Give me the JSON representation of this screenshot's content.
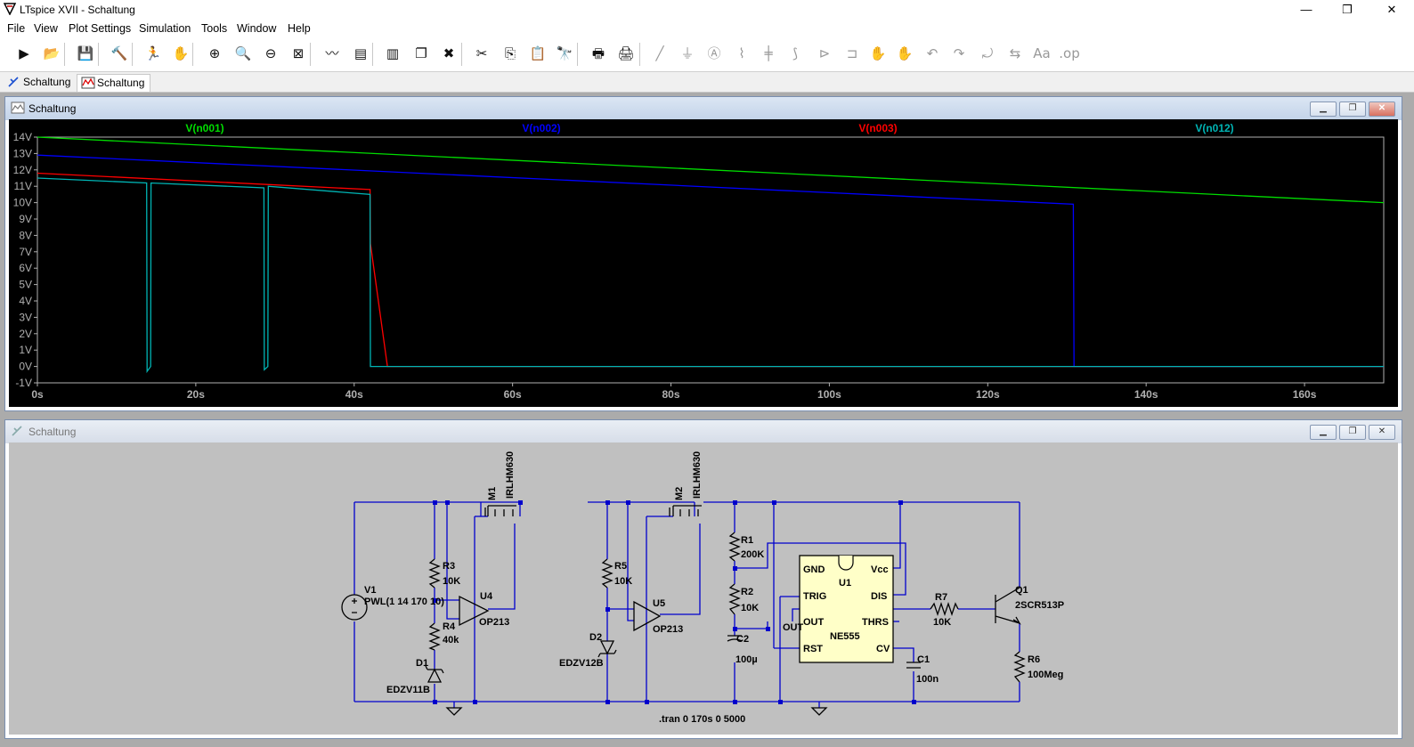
{
  "app": {
    "title": "LTspice XVII - Schaltung",
    "window_controls": [
      "—",
      "❐",
      "✕"
    ]
  },
  "menu": [
    "File",
    "View",
    "Plot Settings",
    "Simulation",
    "Tools",
    "Window",
    "Help"
  ],
  "toolbar_icons": [
    "run-icon",
    "open-icon",
    "save-icon",
    "control-panel-icon",
    "halt-icon",
    "pan-icon",
    "zoom-in-icon",
    "zoom-area-icon",
    "zoom-out-icon",
    "zoom-fit-icon",
    "autorange-icon",
    "tile-vertical-icon",
    "tile-horizontal-icon",
    "cascade-icon",
    "close-all-icon",
    "cut-icon",
    "copy-icon",
    "paste-icon",
    "find-icon",
    "print-icon",
    "print-setup-icon",
    "wire-icon",
    "ground-icon",
    "label-icon",
    "resistor-icon",
    "capacitor-icon",
    "inductor-icon",
    "diode-icon",
    "component-icon",
    "move-icon",
    "drag-icon",
    "undo-icon",
    "redo-icon",
    "rotate-icon",
    "mirror-icon",
    "text-icon",
    "spice-directive-icon"
  ],
  "tabs": [
    {
      "label": "Schaltung",
      "icon": "schematic-icon"
    },
    {
      "label": "Schaltung",
      "icon": "waveform-icon"
    }
  ],
  "plot_window": {
    "title": "Schaltung",
    "chart_data": {
      "type": "line",
      "series": [
        {
          "name": "V(n001)",
          "color": "#00dd00",
          "x": [
            0,
            170
          ],
          "y": [
            14,
            10
          ]
        },
        {
          "name": "V(n002)",
          "color": "#0000ff",
          "x": [
            0,
            130.8,
            130.9,
            170
          ],
          "y": [
            12.9,
            9.9,
            0,
            0
          ]
        },
        {
          "name": "V(n003)",
          "color": "#ff0000",
          "x": [
            0,
            42,
            42.05,
            44.2,
            170
          ],
          "y": [
            11.8,
            10.8,
            7.5,
            0,
            0
          ]
        },
        {
          "name": "V(n012)",
          "color": "#00b4b4",
          "x": [
            0,
            13.8,
            13.85,
            14.3,
            14.35,
            28.6,
            28.65,
            29.1,
            29.15,
            42,
            42.05,
            170
          ],
          "y": [
            11.5,
            11.2,
            -0.3,
            0,
            11.2,
            10.9,
            -0.2,
            0,
            11,
            10.5,
            0,
            0
          ]
        }
      ],
      "xlim": [
        0,
        170
      ],
      "ylim": [
        -1,
        14
      ],
      "xticks": [
        "0s",
        "20s",
        "40s",
        "60s",
        "80s",
        "100s",
        "120s",
        "140s",
        "160s"
      ],
      "xtick_values": [
        0,
        20,
        40,
        60,
        80,
        100,
        120,
        140,
        160
      ],
      "yticks": [
        "14V",
        "13V",
        "12V",
        "11V",
        "10V",
        "9V",
        "8V",
        "7V",
        "6V",
        "5V",
        "4V",
        "3V",
        "2V",
        "1V",
        "0V",
        "-1V"
      ],
      "ytick_values": [
        14,
        13,
        12,
        11,
        10,
        9,
        8,
        7,
        6,
        5,
        4,
        3,
        2,
        1,
        0,
        -1
      ],
      "grid": false,
      "legend": "top"
    }
  },
  "schematic_window": {
    "title": "Schaltung",
    "labels": {
      "v1": "V1",
      "v1_value": "PWL(1 14 170 10)",
      "r3": "R3",
      "r3_value": "10K",
      "r4": "R4",
      "r4_value": "40k",
      "d1": "D1",
      "d1_value": "EDZV11B",
      "m1": "M1",
      "m1_value": "IRLHM630",
      "u4": "U4",
      "u4_value": "OP213",
      "r5": "R5",
      "r5_value": "10K",
      "d2": "D2",
      "d2_value": "EDZV12B",
      "m2": "M2",
      "m2_value": "IRLHM630",
      "u5": "U5",
      "u5_value": "OP213",
      "r1": "R1",
      "r1_value": "200K",
      "r2": "R2",
      "r2_value": "10K",
      "c2": "C2",
      "c2_value": "100µ",
      "u1": "U1",
      "u1_value": "NE555",
      "u1_gnd": "GND",
      "u1_vcc": "Vcc",
      "u1_trig": "TRIG",
      "u1_dis": "DIS",
      "u1_out": "OUT",
      "u1_thrs": "THRS",
      "u1_rst": "RST",
      "u1_cv": "CV",
      "out_label": "OUT",
      "c1": "C1",
      "c1_value": "100n",
      "r7": "R7",
      "r7_value": "10K",
      "q1": "Q1",
      "q1_value": "2SCR513P",
      "r6": "R6",
      "r6_value": "100Meg",
      "directive": ".tran 0 170s 0 5000"
    }
  }
}
